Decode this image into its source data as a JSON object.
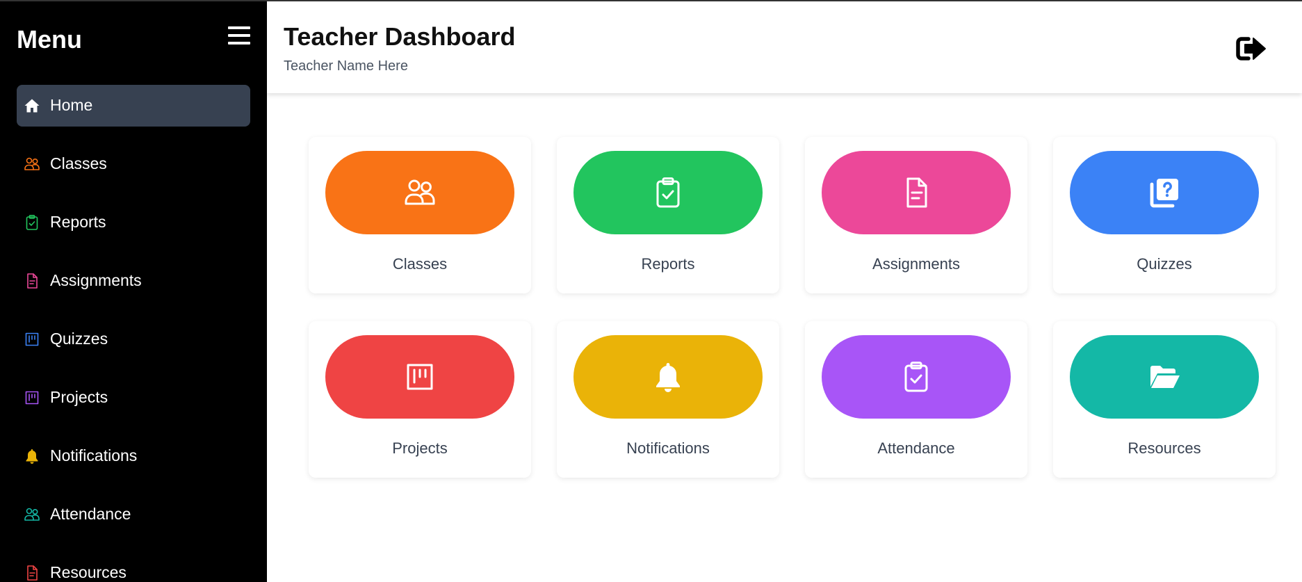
{
  "sidebar": {
    "title": "Menu",
    "items": [
      {
        "label": "Home",
        "icon": "home-icon",
        "color": "#ffffff",
        "active": true
      },
      {
        "label": "Classes",
        "icon": "users-icon",
        "color": "#f97316"
      },
      {
        "label": "Reports",
        "icon": "clipboard-check-icon",
        "color": "#22c55e"
      },
      {
        "label": "Assignments",
        "icon": "document-icon",
        "color": "#ec4899"
      },
      {
        "label": "Quizzes",
        "icon": "board-icon",
        "color": "#3b82f6"
      },
      {
        "label": "Projects",
        "icon": "board-icon",
        "color": "#a855f7"
      },
      {
        "label": "Notifications",
        "icon": "bell-icon",
        "color": "#eab308"
      },
      {
        "label": "Attendance",
        "icon": "users-icon",
        "color": "#14b8a6"
      },
      {
        "label": "Resources",
        "icon": "document-icon",
        "color": "#ef4444"
      }
    ]
  },
  "header": {
    "title": "Teacher Dashboard",
    "subtitle": "Teacher Name Here",
    "logout_icon": "logout-icon"
  },
  "cards": [
    {
      "label": "Classes",
      "icon": "users-icon",
      "color": "#f97316"
    },
    {
      "label": "Reports",
      "icon": "clipboard-check-icon",
      "color": "#22c55e"
    },
    {
      "label": "Assignments",
      "icon": "document-icon",
      "color": "#ec4899"
    },
    {
      "label": "Quizzes",
      "icon": "quiz-icon",
      "color": "#3b82f6"
    },
    {
      "label": "Projects",
      "icon": "board-icon",
      "color": "#ef4444"
    },
    {
      "label": "Notifications",
      "icon": "bell-icon",
      "color": "#eab308"
    },
    {
      "label": "Attendance",
      "icon": "clipboard-check-icon",
      "color": "#a855f7"
    },
    {
      "label": "Resources",
      "icon": "folder-open-icon",
      "color": "#14b8a6"
    }
  ]
}
